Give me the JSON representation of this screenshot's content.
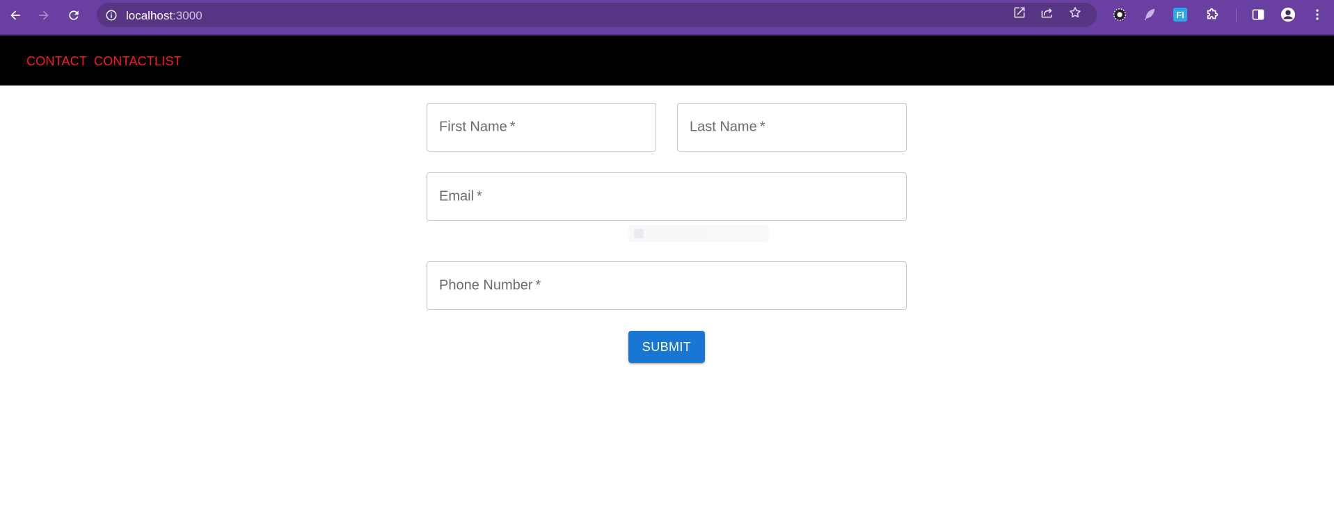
{
  "browser": {
    "url_host": "localhost",
    "url_port": ":3000",
    "icons": {
      "back": "back-arrow-icon",
      "forward": "forward-arrow-icon",
      "reload": "reload-icon",
      "site_info": "info-icon",
      "open_in_app": "open-external-icon",
      "share": "share-icon",
      "bookmark": "star-icon",
      "ext1": "gear-extension-icon",
      "ext2": "feather-extension-icon",
      "ext3": "fi-extension-icon",
      "extensions": "puzzle-icon",
      "side_panel": "side-panel-icon",
      "profile": "profile-icon",
      "menu": "kebab-menu-icon"
    },
    "ext3_label": "FI",
    "colors": {
      "chrome": "#6a3fa2",
      "omnibox": "#573582"
    }
  },
  "appbar": {
    "links": [
      "CONTACT",
      "CONTACTLIST"
    ],
    "link_color": "#ff1a1a",
    "background": "#000000"
  },
  "form": {
    "first_name": {
      "label": "First Name",
      "required_mark": "*"
    },
    "last_name": {
      "label": "Last Name",
      "required_mark": "*"
    },
    "email": {
      "label": "Email",
      "required_mark": "*"
    },
    "phone": {
      "label": "Phone Number",
      "required_mark": "*"
    },
    "submit_label": "SUBMIT",
    "submit_color": "#1976d2"
  }
}
